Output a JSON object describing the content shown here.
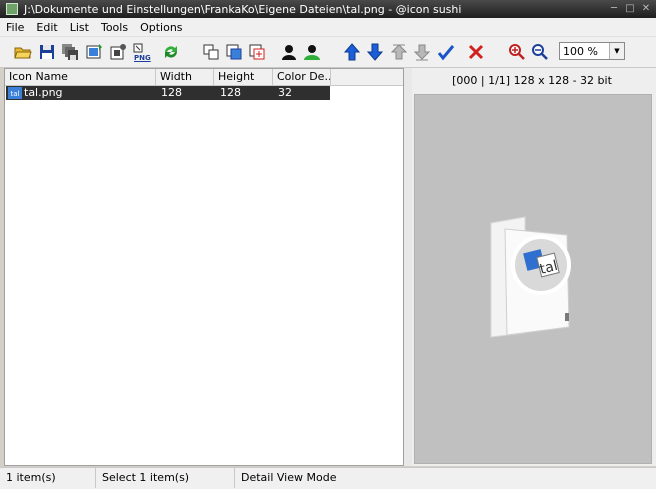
{
  "window": {
    "title": "J:\\Dokumente und Einstellungen\\FrankaKo\\Eigene Dateien\\tal.png - @icon sushi"
  },
  "menu": {
    "items": [
      "File",
      "Edit",
      "List",
      "Tools",
      "Options"
    ]
  },
  "toolbar": {
    "png_label": "PNG",
    "zoom_value": "100 %"
  },
  "list": {
    "columns": [
      "Icon Name",
      "Width",
      "Height",
      "Color De..."
    ],
    "rows": [
      {
        "name": "tal.png",
        "width": "128",
        "height": "128",
        "depth": "32",
        "icon_text": "tal"
      }
    ]
  },
  "preview": {
    "info": "[000 | 1/1] 128 x 128 - 32 bit",
    "icon_text": "tal"
  },
  "status": {
    "count": "1 item(s)",
    "selected": "Select 1 item(s)",
    "mode": "Detail View Mode"
  },
  "colors": {
    "arrow_blue": "#1a5fd8",
    "check_blue": "#1a54c8",
    "delete_red": "#d02020",
    "person_green": "#2fae3a"
  }
}
